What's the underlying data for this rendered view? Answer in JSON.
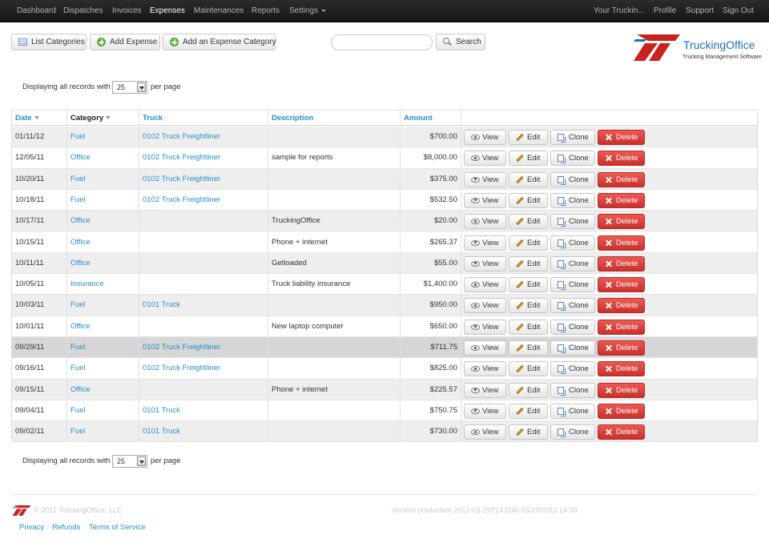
{
  "nav": {
    "left": [
      "Dashboard",
      "Dispatches",
      "Invoices",
      "Expenses",
      "Maintenances",
      "Reports",
      "Settings"
    ],
    "active": "Expenses",
    "right": [
      "Your Truckin...",
      "Profile",
      "Support",
      "Sign Out"
    ]
  },
  "toolbar": {
    "list_categories": "List Categories",
    "add_expense": "Add Expense",
    "add_category": "Add an Expense Category",
    "search_value": "",
    "search_button": "Search"
  },
  "logo": {
    "name": "TruckingOffice",
    "tagline": "Trucking Management Software",
    "colors": {
      "red": "#c9211e",
      "blue": "#1d6fb8"
    }
  },
  "pagination": {
    "prefix": "Displaying all records with",
    "per_page": "25",
    "suffix": "per page"
  },
  "table": {
    "columns": [
      "Date",
      "Category",
      "Truck",
      "Description",
      "Amount"
    ],
    "actions": {
      "view": "View",
      "edit": "Edit",
      "clone": "Clone",
      "delete": "Delete"
    },
    "rows": [
      {
        "date": "01/11/12",
        "category": "Fuel",
        "truck": "0102 Truck Freightliner",
        "description": "",
        "amount": "$700.00"
      },
      {
        "date": "12/05/11",
        "category": "Office",
        "truck": "0102 Truck Freightliner",
        "description": "sample for reports",
        "amount": "$8,000.00"
      },
      {
        "date": "10/20/11",
        "category": "Fuel",
        "truck": "0102 Truck Freightliner",
        "description": "",
        "amount": "$375.00"
      },
      {
        "date": "10/18/11",
        "category": "Fuel",
        "truck": "0102 Truck Freightliner",
        "description": "",
        "amount": "$532.50"
      },
      {
        "date": "10/17/11",
        "category": "Office",
        "truck": "",
        "description": "TruckingOffice",
        "amount": "$20.00"
      },
      {
        "date": "10/15/11",
        "category": "Office",
        "truck": "",
        "description": "Phone + internet",
        "amount": "$265.37"
      },
      {
        "date": "10/11/11",
        "category": "Office",
        "truck": "",
        "description": "Getloaded",
        "amount": "$55.00"
      },
      {
        "date": "10/05/11",
        "category": "Insurance",
        "truck": "",
        "description": "Truck liability insurance",
        "amount": "$1,400.00"
      },
      {
        "date": "10/03/11",
        "category": "Fuel",
        "truck": "0101 Truck",
        "description": "",
        "amount": "$950.00"
      },
      {
        "date": "10/01/11",
        "category": "Office",
        "truck": "",
        "description": "New laptop computer",
        "amount": "$650.00"
      },
      {
        "date": "09/29/11",
        "category": "Fuel",
        "truck": "0102 Truck Freightliner",
        "description": "",
        "amount": "$711.75"
      },
      {
        "date": "09/16/11",
        "category": "Fuel",
        "truck": "0102 Truck Freightliner",
        "description": "",
        "amount": "$825.00"
      },
      {
        "date": "09/15/11",
        "category": "Office",
        "truck": "",
        "description": "Phone + internet",
        "amount": "$225.57"
      },
      {
        "date": "09/04/11",
        "category": "Fuel",
        "truck": "0101 Truck",
        "description": "",
        "amount": "$750.75"
      },
      {
        "date": "09/02/11",
        "category": "Fuel",
        "truck": "0101 Truck",
        "description": "",
        "amount": "$730.00"
      }
    ],
    "highlighted_row": 10
  },
  "footer": {
    "copyright": "© 2012 TruckingOffice, LLC",
    "version": "Version production-2012-03-29T143246 03/29/2012 14:33",
    "links": [
      "Privacy",
      "Refunds",
      "Terms of Service"
    ]
  }
}
